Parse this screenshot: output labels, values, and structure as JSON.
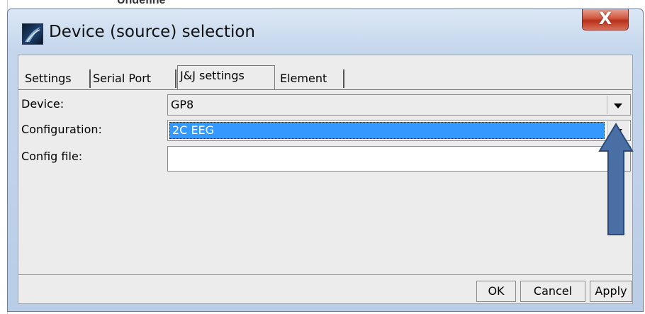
{
  "background": {
    "partial_text": "Undefine"
  },
  "window": {
    "title": "Device (source) selection",
    "close_label": "X"
  },
  "tabs": [
    {
      "label": "Settings"
    },
    {
      "label": "Serial Port"
    },
    {
      "label": "J&J settings",
      "active": true
    },
    {
      "label": "Element"
    }
  ],
  "form": {
    "device": {
      "label": "Device:",
      "value": "GP8"
    },
    "configuration": {
      "label": "Configuration:",
      "value": "2C EEG"
    },
    "config_file": {
      "label": "Config file:",
      "value": ""
    }
  },
  "buttons": {
    "ok": "OK",
    "cancel": "Cancel",
    "apply": "Apply"
  },
  "colors": {
    "selection": "#3399ff",
    "annotation_arrow": "#4a6fa5",
    "close_button": "#c8452f"
  },
  "icons": {
    "app": "app-logo-icon",
    "dropdown": "chevron-down-icon",
    "annotation": "up-arrow-icon"
  }
}
